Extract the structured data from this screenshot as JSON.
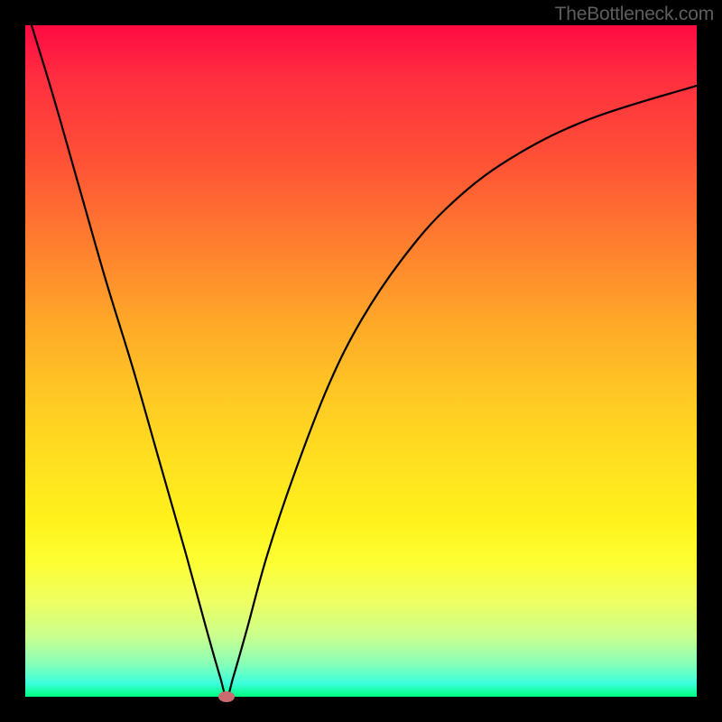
{
  "watermark": {
    "text": "TheBottleneck.com"
  },
  "chart_data": {
    "type": "line",
    "title": "",
    "xlabel": "",
    "ylabel": "",
    "xlim": [
      0,
      100
    ],
    "ylim": [
      0,
      100
    ],
    "series": [
      {
        "name": "bottleneck-curve",
        "x": [
          0,
          4,
          8,
          12,
          16,
          20,
          24,
          27,
          29,
          30,
          31,
          33,
          36,
          40,
          45,
          50,
          56,
          63,
          72,
          84,
          100
        ],
        "y": [
          103,
          90,
          76,
          62,
          49,
          35,
          21,
          10,
          3,
          0,
          3,
          10,
          21,
          33,
          46,
          56,
          65,
          73,
          80,
          86,
          91
        ]
      }
    ],
    "marker": {
      "x": 30,
      "y": 0,
      "color": "#cc6b6f"
    },
    "background_gradient": {
      "top": "#ff0a43",
      "mid": "#ffe020",
      "bottom": "#00ff80"
    }
  }
}
